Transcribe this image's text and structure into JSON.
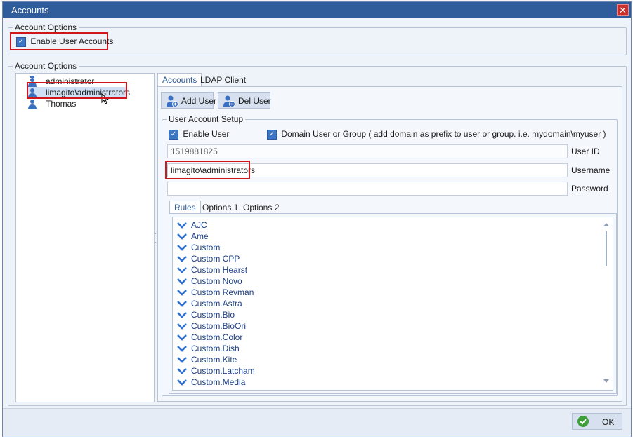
{
  "window": {
    "title": "Accounts",
    "close_glyph": "✕"
  },
  "account_options_top": {
    "legend": "Account Options",
    "enable_user_accounts": {
      "label": "Enable User Accounts",
      "checked": true
    }
  },
  "account_options_main": {
    "legend": "Account Options"
  },
  "users_tree": {
    "items": [
      {
        "label": "administrator",
        "icon": "user-crown-icon"
      },
      {
        "label": "limagito\\administrators",
        "icon": "user-group-icon",
        "selected": true
      },
      {
        "label": "Thomas",
        "icon": "user-icon"
      }
    ]
  },
  "tabs": [
    {
      "label": "Accounts",
      "active": true
    },
    {
      "label": "LDAP Client",
      "active": false
    }
  ],
  "toolbar": {
    "add_user_label": "Add User",
    "del_user_label": "Del User"
  },
  "user_account_setup": {
    "legend": "User Account Setup",
    "enable_user_label": "Enable User",
    "enable_user_checked": true,
    "domain_user_label": "Domain User or Group ( add domain as prefix to user or group. i.e. mydomain\\myuser )",
    "domain_user_checked": true,
    "user_id_value": "1519881825",
    "user_id_label": "User ID",
    "username_value": "limagito\\administrators",
    "username_label": "Username",
    "password_value": "",
    "password_label": "Password"
  },
  "inner_tabs": [
    {
      "label": "Rules",
      "active": true
    },
    {
      "label": "Options 1",
      "active": false
    },
    {
      "label": "Options 2",
      "active": false
    }
  ],
  "rules": [
    "AJC",
    "Ame",
    "Custom",
    "Custom CPP",
    "Custom Hearst",
    "Custom Novo",
    "Custom Revman",
    "Custom.Astra",
    "Custom.Bio",
    "Custom.BioOri",
    "Custom.Color",
    "Custom.Dish",
    "Custom.Kite",
    "Custom.Latcham",
    "Custom.Media"
  ],
  "footer": {
    "ok_label": "OK"
  },
  "colors": {
    "title_bar": "#2f5d9c",
    "highlight_border": "#d0151b",
    "rule_text": "#1a3f86"
  }
}
